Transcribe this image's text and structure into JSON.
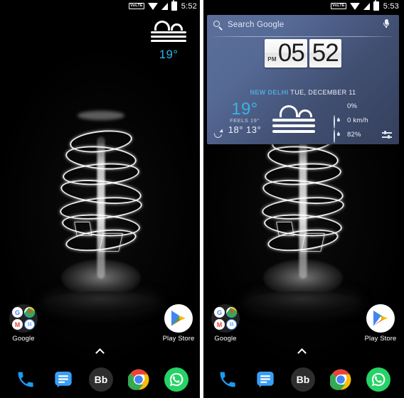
{
  "screens": [
    {
      "id": "left",
      "statusbar": {
        "network_label": "VoLTE",
        "time": "5:52",
        "icons": [
          "volte-icon",
          "wifi-icon",
          "signal-icon",
          "battery-icon"
        ]
      },
      "mini_weather": {
        "temp": "19°",
        "icon": "fog-icon"
      },
      "has_widget": false
    },
    {
      "id": "right",
      "statusbar": {
        "network_label": "VoLTE",
        "time": "5:53",
        "icons": [
          "volte-icon",
          "wifi-icon",
          "signal-icon",
          "battery-icon"
        ]
      },
      "has_widget": true,
      "widget": {
        "search": {
          "placeholder": "Search Google",
          "search_icon": "search-icon",
          "mic_icon": "microphone-icon"
        },
        "clock": {
          "ampm": "PM",
          "hours": "05",
          "minutes": "52"
        },
        "date": {
          "city": "NEW DELHI",
          "date_text": "TUE, DECEMBER 11"
        },
        "weather": {
          "temp": "19°",
          "feels_like": "FEELS 19°",
          "high_low": "18° 13°",
          "condition_icon": "fog-icon"
        },
        "stats": [
          {
            "icon": "precipitation-droplet-icon",
            "value": "0%"
          },
          {
            "icon": "wind-speed-icon",
            "value": "0 km/h"
          },
          {
            "icon": "humidity-icon",
            "value": "82%"
          }
        ],
        "actions": {
          "refresh_icon": "refresh-icon",
          "settings_icon": "sliders-settings-icon"
        }
      }
    }
  ],
  "home": {
    "folder": {
      "label": "Google",
      "apps": [
        {
          "name": "google-search",
          "glyph": "G",
          "color": "#4285F4"
        },
        {
          "name": "google-maps",
          "glyph": "",
          "color": "#34A853"
        },
        {
          "name": "gmail",
          "glyph": "M",
          "color": "#EA4335"
        },
        {
          "name": "google-calendar",
          "glyph": "11",
          "color": "#4285F4"
        }
      ]
    },
    "playstore": {
      "label": "Play Store",
      "icon": "play-store-icon"
    },
    "drawer_indicator": "chevron-up-icon",
    "dock": [
      {
        "name": "phone",
        "label": "Phone",
        "color": "#1a9bf0"
      },
      {
        "name": "messages",
        "label": "Messages",
        "color": "#3b9ef5"
      },
      {
        "name": "bb-app",
        "label": "Bb",
        "color": "#2e2e2e"
      },
      {
        "name": "chrome",
        "label": "Chrome",
        "color": "#ffffff"
      },
      {
        "name": "whatsapp",
        "label": "WhatsApp",
        "color": "#25D366"
      }
    ]
  },
  "colors": {
    "accent_cyan": "#38b4e6",
    "widget_blue": "#5c6f9b",
    "city_blue": "#4fa8d8",
    "background": "#000000"
  }
}
